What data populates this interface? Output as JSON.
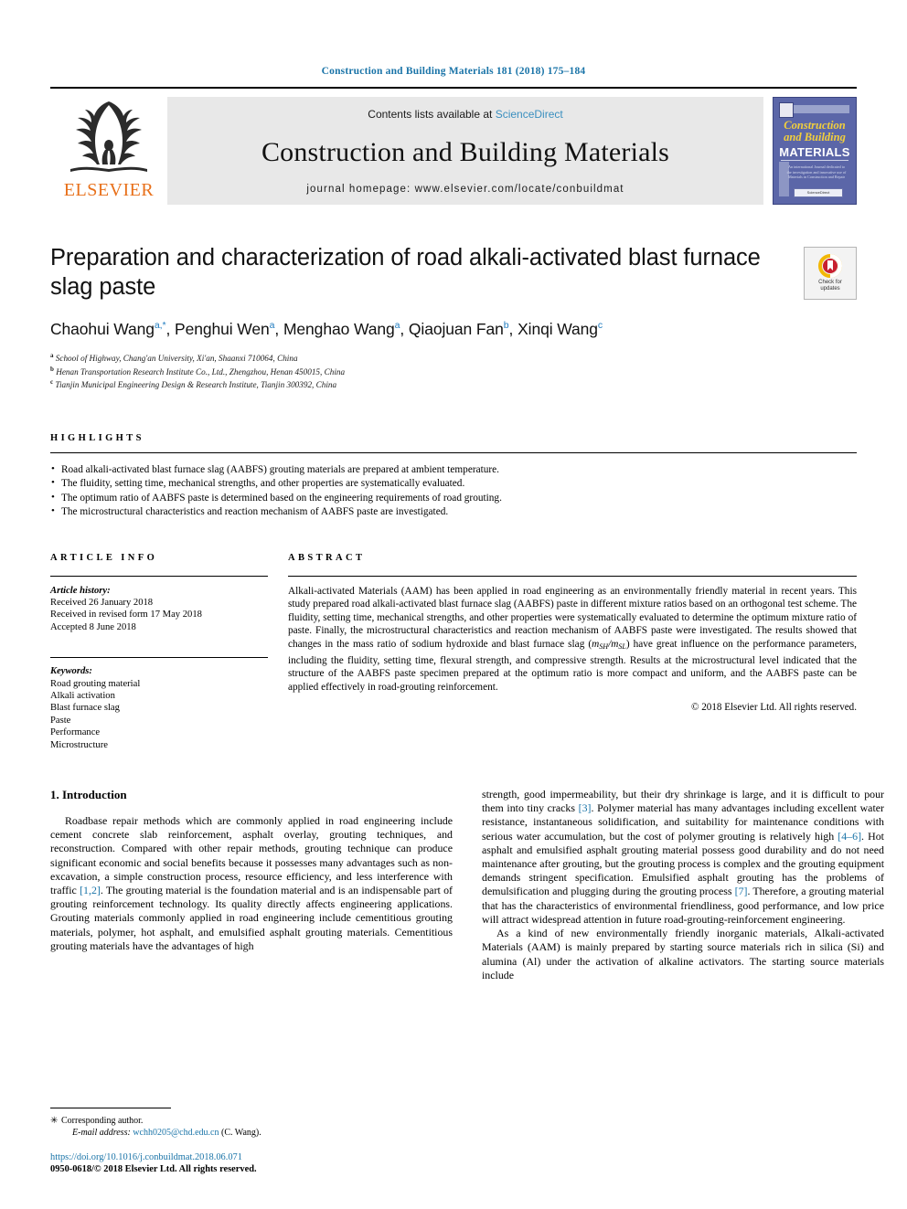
{
  "running_head": "Construction and Building Materials 181 (2018) 175–184",
  "banner": {
    "publisher": "ELSEVIER",
    "contents_prefix": "Contents lists available at ",
    "contents_link": "ScienceDirect",
    "journal_title": "Construction and Building Materials",
    "homepage": "journal homepage: www.elsevier.com/locate/conbuildmat",
    "cover": {
      "line1": "Construction",
      "line2": "and Building",
      "line3": "MATERIALS",
      "blurb": "An international Journal dedicated to the investigation and innovative use of Materials in Construction and Repair",
      "footer": "ScienceDirect"
    }
  },
  "article": {
    "title": "Preparation and characterization of road alkali-activated blast furnace slag paste",
    "crossmark": {
      "line1": "Check for",
      "line2": "updates"
    },
    "authors": [
      {
        "name": "Chaohui Wang",
        "marks": "a,*"
      },
      {
        "name": "Penghui Wen",
        "marks": "a"
      },
      {
        "name": "Menghao Wang",
        "marks": "a"
      },
      {
        "name": "Qiaojuan Fan",
        "marks": "b"
      },
      {
        "name": "Xinqi Wang",
        "marks": "c"
      }
    ],
    "affiliations": [
      {
        "mark": "a",
        "text": "School of Highway, Chang'an University, Xi'an, Shaanxi 710064, China"
      },
      {
        "mark": "b",
        "text": "Henan Transportation Research Institute Co., Ltd., Zhengzhou, Henan 450015, China"
      },
      {
        "mark": "c",
        "text": "Tianjin Municipal Engineering Design & Research Institute, Tianjin 300392, China"
      }
    ]
  },
  "highlights": {
    "label": "HIGHLIGHTS",
    "items": [
      "Road alkali-activated blast furnace slag (AABFS) grouting materials are prepared at ambient temperature.",
      "The fluidity, setting time, mechanical strengths, and other properties are systematically evaluated.",
      "The optimum ratio of AABFS paste is determined based on the engineering requirements of road grouting.",
      "The microstructural characteristics and reaction mechanism of AABFS paste are investigated."
    ]
  },
  "article_info": {
    "label": "ARTICLE INFO",
    "history_label": "Article history:",
    "history": [
      "Received 26 January 2018",
      "Received in revised form 17 May 2018",
      "Accepted 8 June 2018"
    ],
    "keywords_label": "Keywords:",
    "keywords": [
      "Road grouting material",
      "Alkali activation",
      "Blast furnace slag",
      "Paste",
      "Performance",
      "Microstructure"
    ]
  },
  "abstract": {
    "label": "ABSTRACT",
    "part1": "Alkali-activated Materials (AAM) has been applied in road engineering as an environmentally friendly material in recent years. This study prepared road alkali-activated blast furnace slag (AABFS) paste in different mixture ratios based on an orthogonal test scheme. The fluidity, setting time, mechanical strengths, and other properties were systematically evaluated to determine the optimum mixture ratio of paste. Finally, the microstructural characteristics and reaction mechanism of AABFS paste were investigated. The results showed that changes in the mass ratio of sodium hydroxide and blast furnace slag (",
    "formula": "m_SH/m_SL",
    "part2": ") have great influence on the performance parameters, including the fluidity, setting time, flexural strength, and compressive strength. Results at the microstructural level indicated that the structure of the AABFS paste specimen prepared at the optimum ratio is more compact and uniform, and the AABFS paste can be applied effectively in road-grouting reinforcement.",
    "copyright": "© 2018 Elsevier Ltd. All rights reserved."
  },
  "body": {
    "section_title": "1. Introduction",
    "left_p1_a": "Roadbase repair methods which are commonly applied in road engineering include cement concrete slab reinforcement, asphalt overlay, grouting techniques, and reconstruction. Compared with other repair methods, grouting technique can produce significant economic and social benefits because it possesses many advantages such as non-excavation, a simple construction process, resource efficiency, and less interference with traffic ",
    "left_ref1": "[1,2]",
    "left_p1_b": ". The grouting material is the foundation material and is an indispensable part of grouting reinforcement technology. Its quality directly affects engineering applications. Grouting materials commonly applied in road engineering include cementitious grouting materials, polymer, hot asphalt, and emulsified asphalt grouting materials. Cementitious grouting materials have the advantages of high",
    "right_p1_a": "strength, good impermeability, but their dry shrinkage is large, and it is difficult to pour them into tiny cracks ",
    "right_ref1": "[3]",
    "right_p1_b": ". Polymer material has many advantages including excellent water resistance, instantaneous solidification, and suitability for maintenance conditions with serious water accumulation, but the cost of polymer grouting is relatively high ",
    "right_ref2": "[4–6]",
    "right_p1_c": ". Hot asphalt and emulsified asphalt grouting material possess good durability and do not need maintenance after grouting, but the grouting process is complex and the grouting equipment demands stringent specification. Emulsified asphalt grouting has the problems of demulsification and plugging during the grouting process ",
    "right_ref3": "[7]",
    "right_p1_d": ". Therefore, a grouting material that has the characteristics of environmental friendliness, good performance, and low price will attract widespread attention in future road-grouting-reinforcement engineering.",
    "right_p2": "As a kind of new environmentally friendly inorganic materials, Alkali-activated Materials (AAM) is mainly prepared by starting source materials rich in silica (Si) and alumina (Al) under the activation of alkaline activators. The starting source materials include"
  },
  "footnotes": {
    "corresponding": "Corresponding author.",
    "email_label": "E-mail address:",
    "email": "wchh0205@chd.edu.cn",
    "email_suffix": "(C. Wang).",
    "doi": "https://doi.org/10.1016/j.conbuildmat.2018.06.071",
    "issn_line": "0950-0618/© 2018 Elsevier Ltd. All rights reserved."
  },
  "colors": {
    "link": "#1a74a8",
    "sciencedirect": "#3a8fbf",
    "elsevier_orange": "#e8701a",
    "cover_bg": "#5b66a8",
    "cover_yellow": "#f2cf3c"
  }
}
